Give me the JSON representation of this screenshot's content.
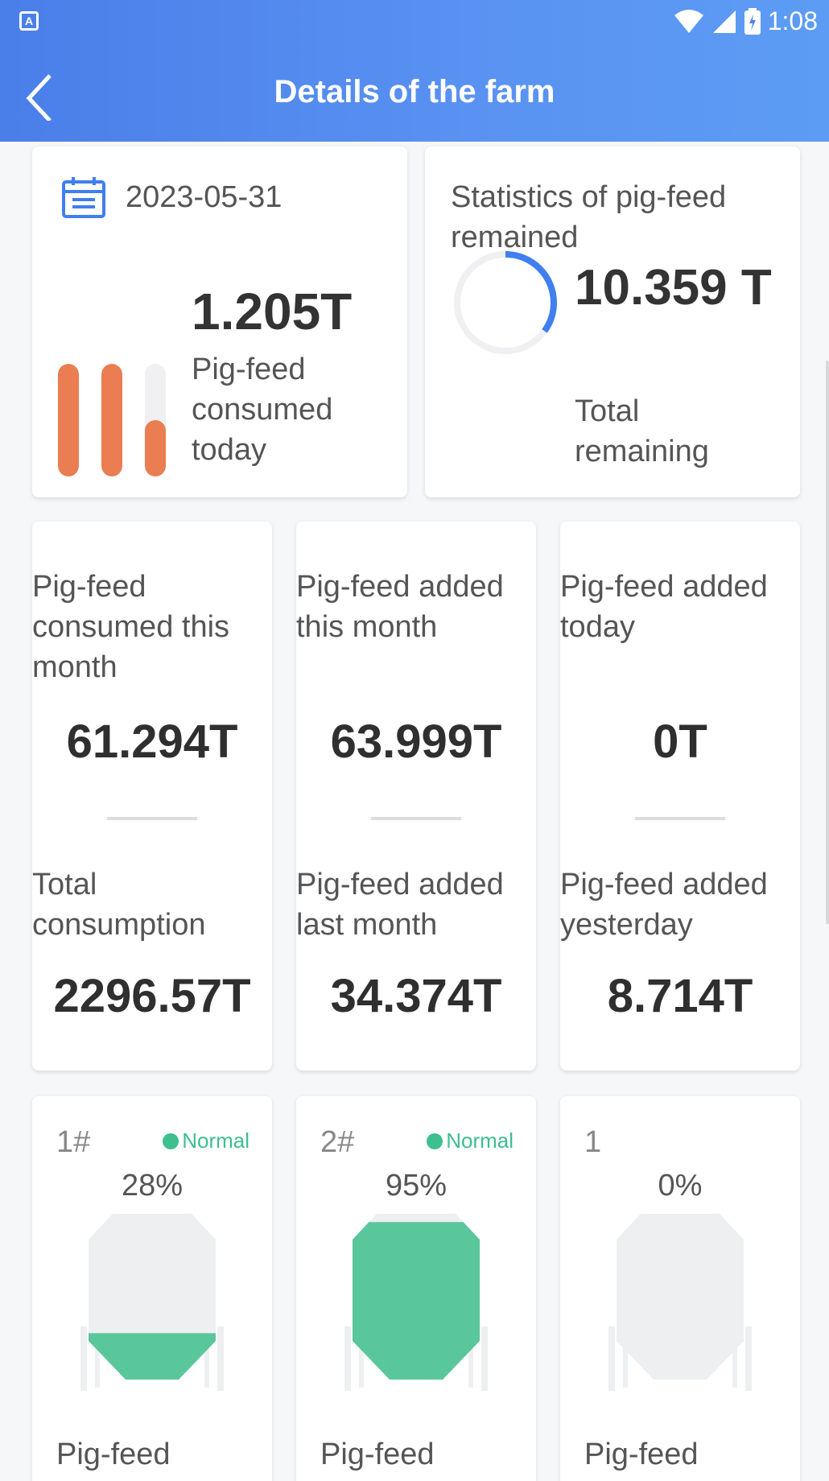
{
  "status_bar": {
    "time": "1:08",
    "left_icon": "app-a-icon",
    "icons": [
      "wifi-icon",
      "signal-icon",
      "battery-icon"
    ]
  },
  "header": {
    "title": "Details of the farm",
    "back_icon": "back-chevron-icon"
  },
  "today_card": {
    "date": "2023-05-31",
    "amount": "1.205T",
    "label": "Pig-feed consumed today",
    "bars": [
      1.0,
      1.0,
      0.5
    ],
    "bar_color": "#ea7d52"
  },
  "remaining_card": {
    "title": "Statistics of pig-feed remained",
    "amount": "10.359 T",
    "label": "Total remaining",
    "ring_fraction": 0.35,
    "ring_color": "#3f7ff0"
  },
  "metrics": [
    {
      "top_label": "Pig-feed consumed this month",
      "top_value": "61.294T",
      "bottom_label": "Total consumption",
      "bottom_value": "2296.57T"
    },
    {
      "top_label": "Pig-feed added this month",
      "top_value": "63.999T",
      "bottom_label": "Pig-feed added last month",
      "bottom_value": "34.374T"
    },
    {
      "top_label": "Pig-feed added today",
      "top_value": "0T",
      "bottom_label": "Pig-feed added yesterday",
      "bottom_value": "8.714T"
    }
  ],
  "tanks": [
    {
      "id": "1#",
      "status": "Normal",
      "percent": "28%",
      "fill": 0.28,
      "label": "Pig-feed remained"
    },
    {
      "id": "2#",
      "status": "Normal",
      "percent": "95%",
      "fill": 0.95,
      "label": "Pig-feed remained"
    },
    {
      "id": "1",
      "status": "",
      "percent": "0%",
      "fill": 0.0,
      "label": "Pig-feed remained"
    }
  ],
  "colors": {
    "header": "#4f88ee",
    "fill_green": "#5ac69c",
    "status_green": "#3dbf8e",
    "tank_empty": "#eeeff1"
  }
}
